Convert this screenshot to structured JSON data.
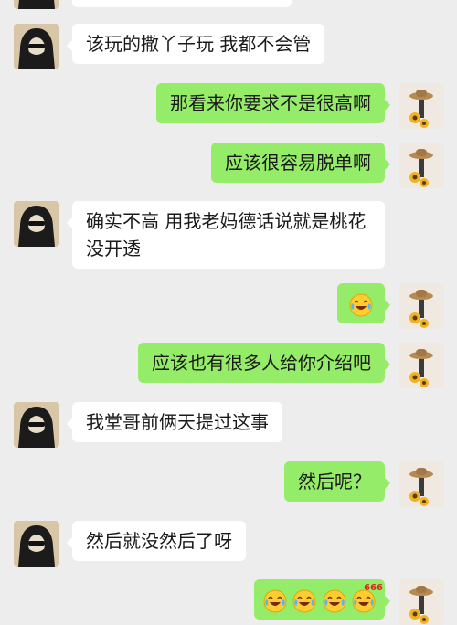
{
  "messages": [
    {
      "side": "in",
      "text": "该玩的撒丫子玩 我都不会管"
    },
    {
      "side": "out",
      "text": "那看来你要求不是很高啊"
    },
    {
      "side": "out",
      "text": "应该很容易脱单啊"
    },
    {
      "side": "in",
      "text": "确实不高 用我老妈德话说就是桃花没开透"
    },
    {
      "side": "out",
      "emoji": "laugh-cry-emoji"
    },
    {
      "side": "out",
      "text": "应该也有很多人给你介绍吧"
    },
    {
      "side": "in",
      "text": "我堂哥前俩天提过这事"
    },
    {
      "side": "out",
      "text": "然后呢？"
    },
    {
      "side": "in",
      "text": "然后就没然后了呀"
    },
    {
      "side": "out",
      "emoji": "laugh-cry-emoji x3 + 666-emoji",
      "badge": "666"
    }
  ],
  "colors": {
    "background": "#ededed",
    "incoming_bubble": "#ffffff",
    "outgoing_bubble": "#95ec69",
    "text": "#191919"
  }
}
